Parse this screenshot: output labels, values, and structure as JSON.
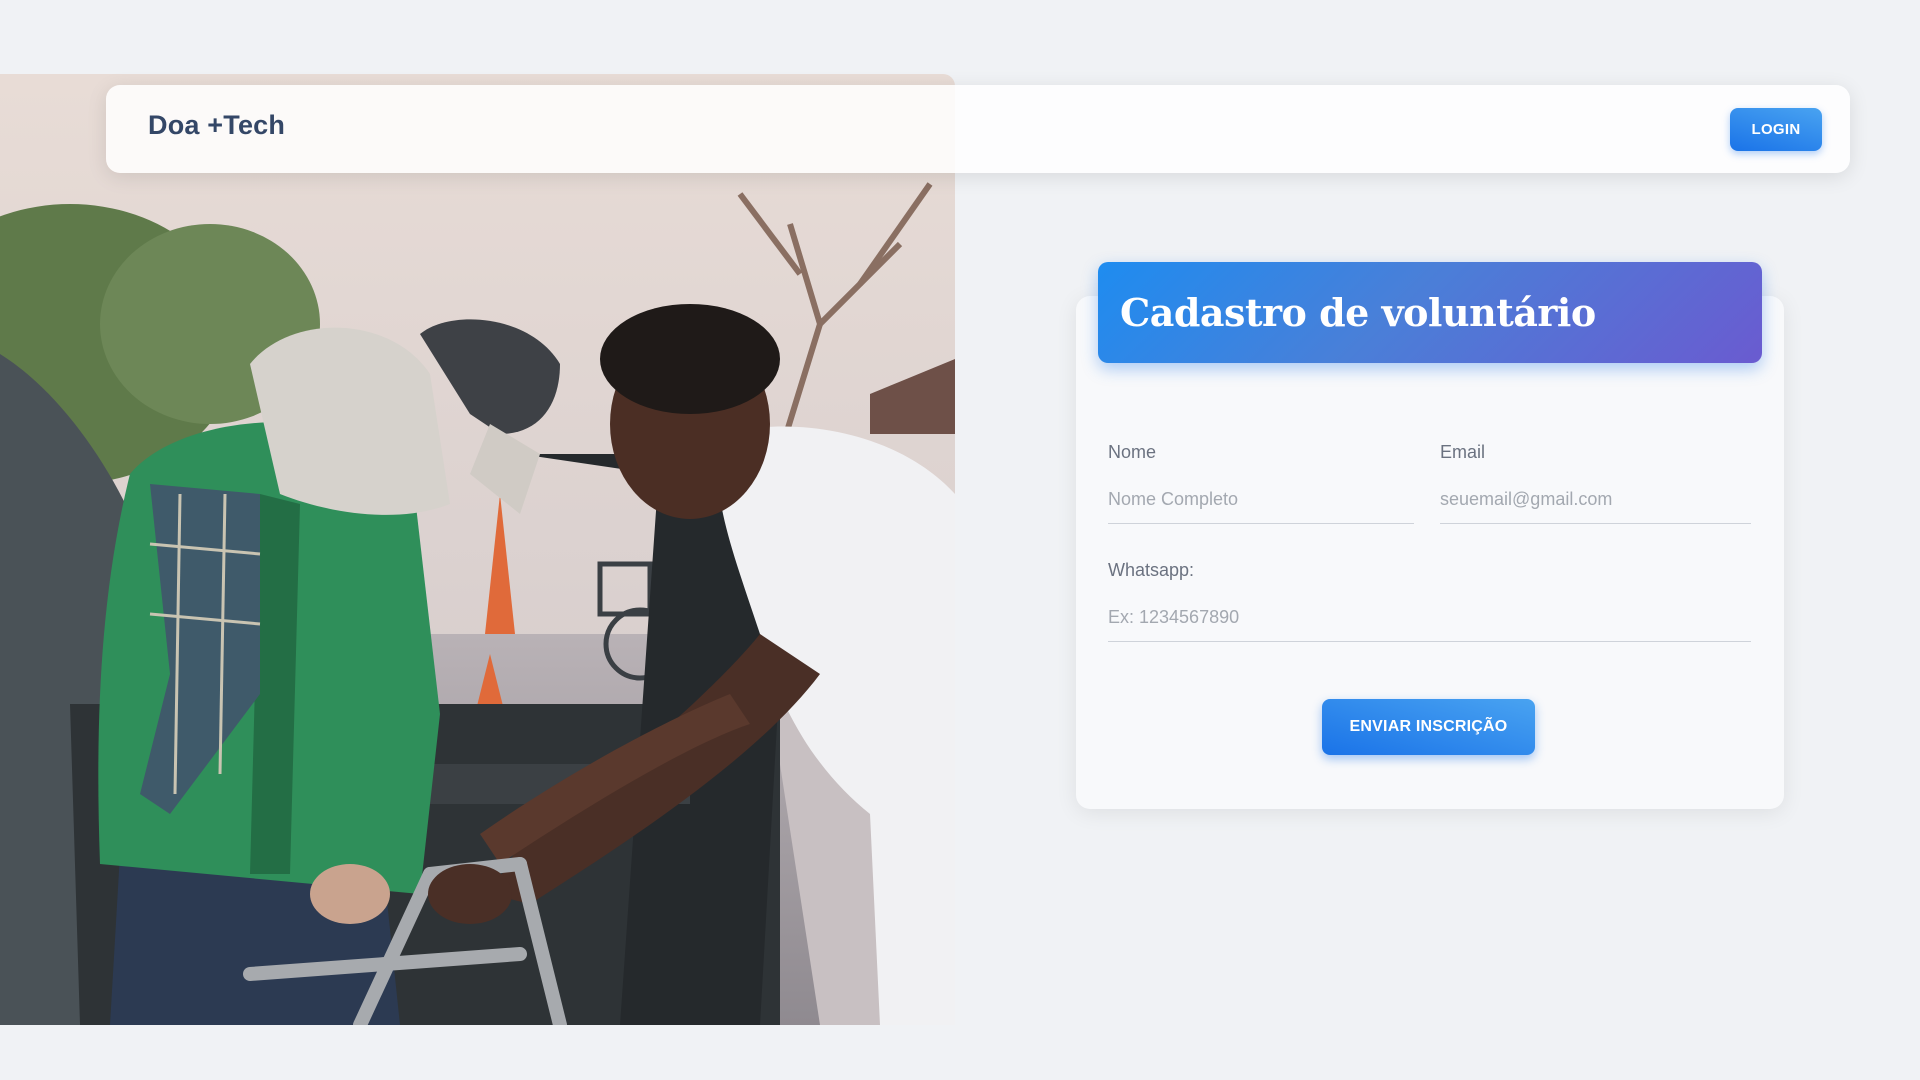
{
  "navbar": {
    "brand": "Doa +Tech",
    "login_label": "LOGIN"
  },
  "hero": {
    "icon": "volunteer-helping-elder-photo"
  },
  "form": {
    "title": "Cadastro de voluntário",
    "fields": {
      "nome": {
        "label": "Nome",
        "placeholder": "Nome Completo",
        "value": ""
      },
      "email": {
        "label": "Email",
        "placeholder": "seuemail@gmail.com",
        "value": ""
      },
      "whatsapp": {
        "label": "Whatsapp:",
        "placeholder": "Ex: 1234567890",
        "value": ""
      }
    },
    "submit_label": "ENVIAR INSCRIÇÃO"
  },
  "colors": {
    "accent": "#1A73E8",
    "accent_light": "#49a3f1",
    "header_gradient_end": "#6a5bd0",
    "brand_text": "#344767",
    "background": "#f0f2f5"
  }
}
